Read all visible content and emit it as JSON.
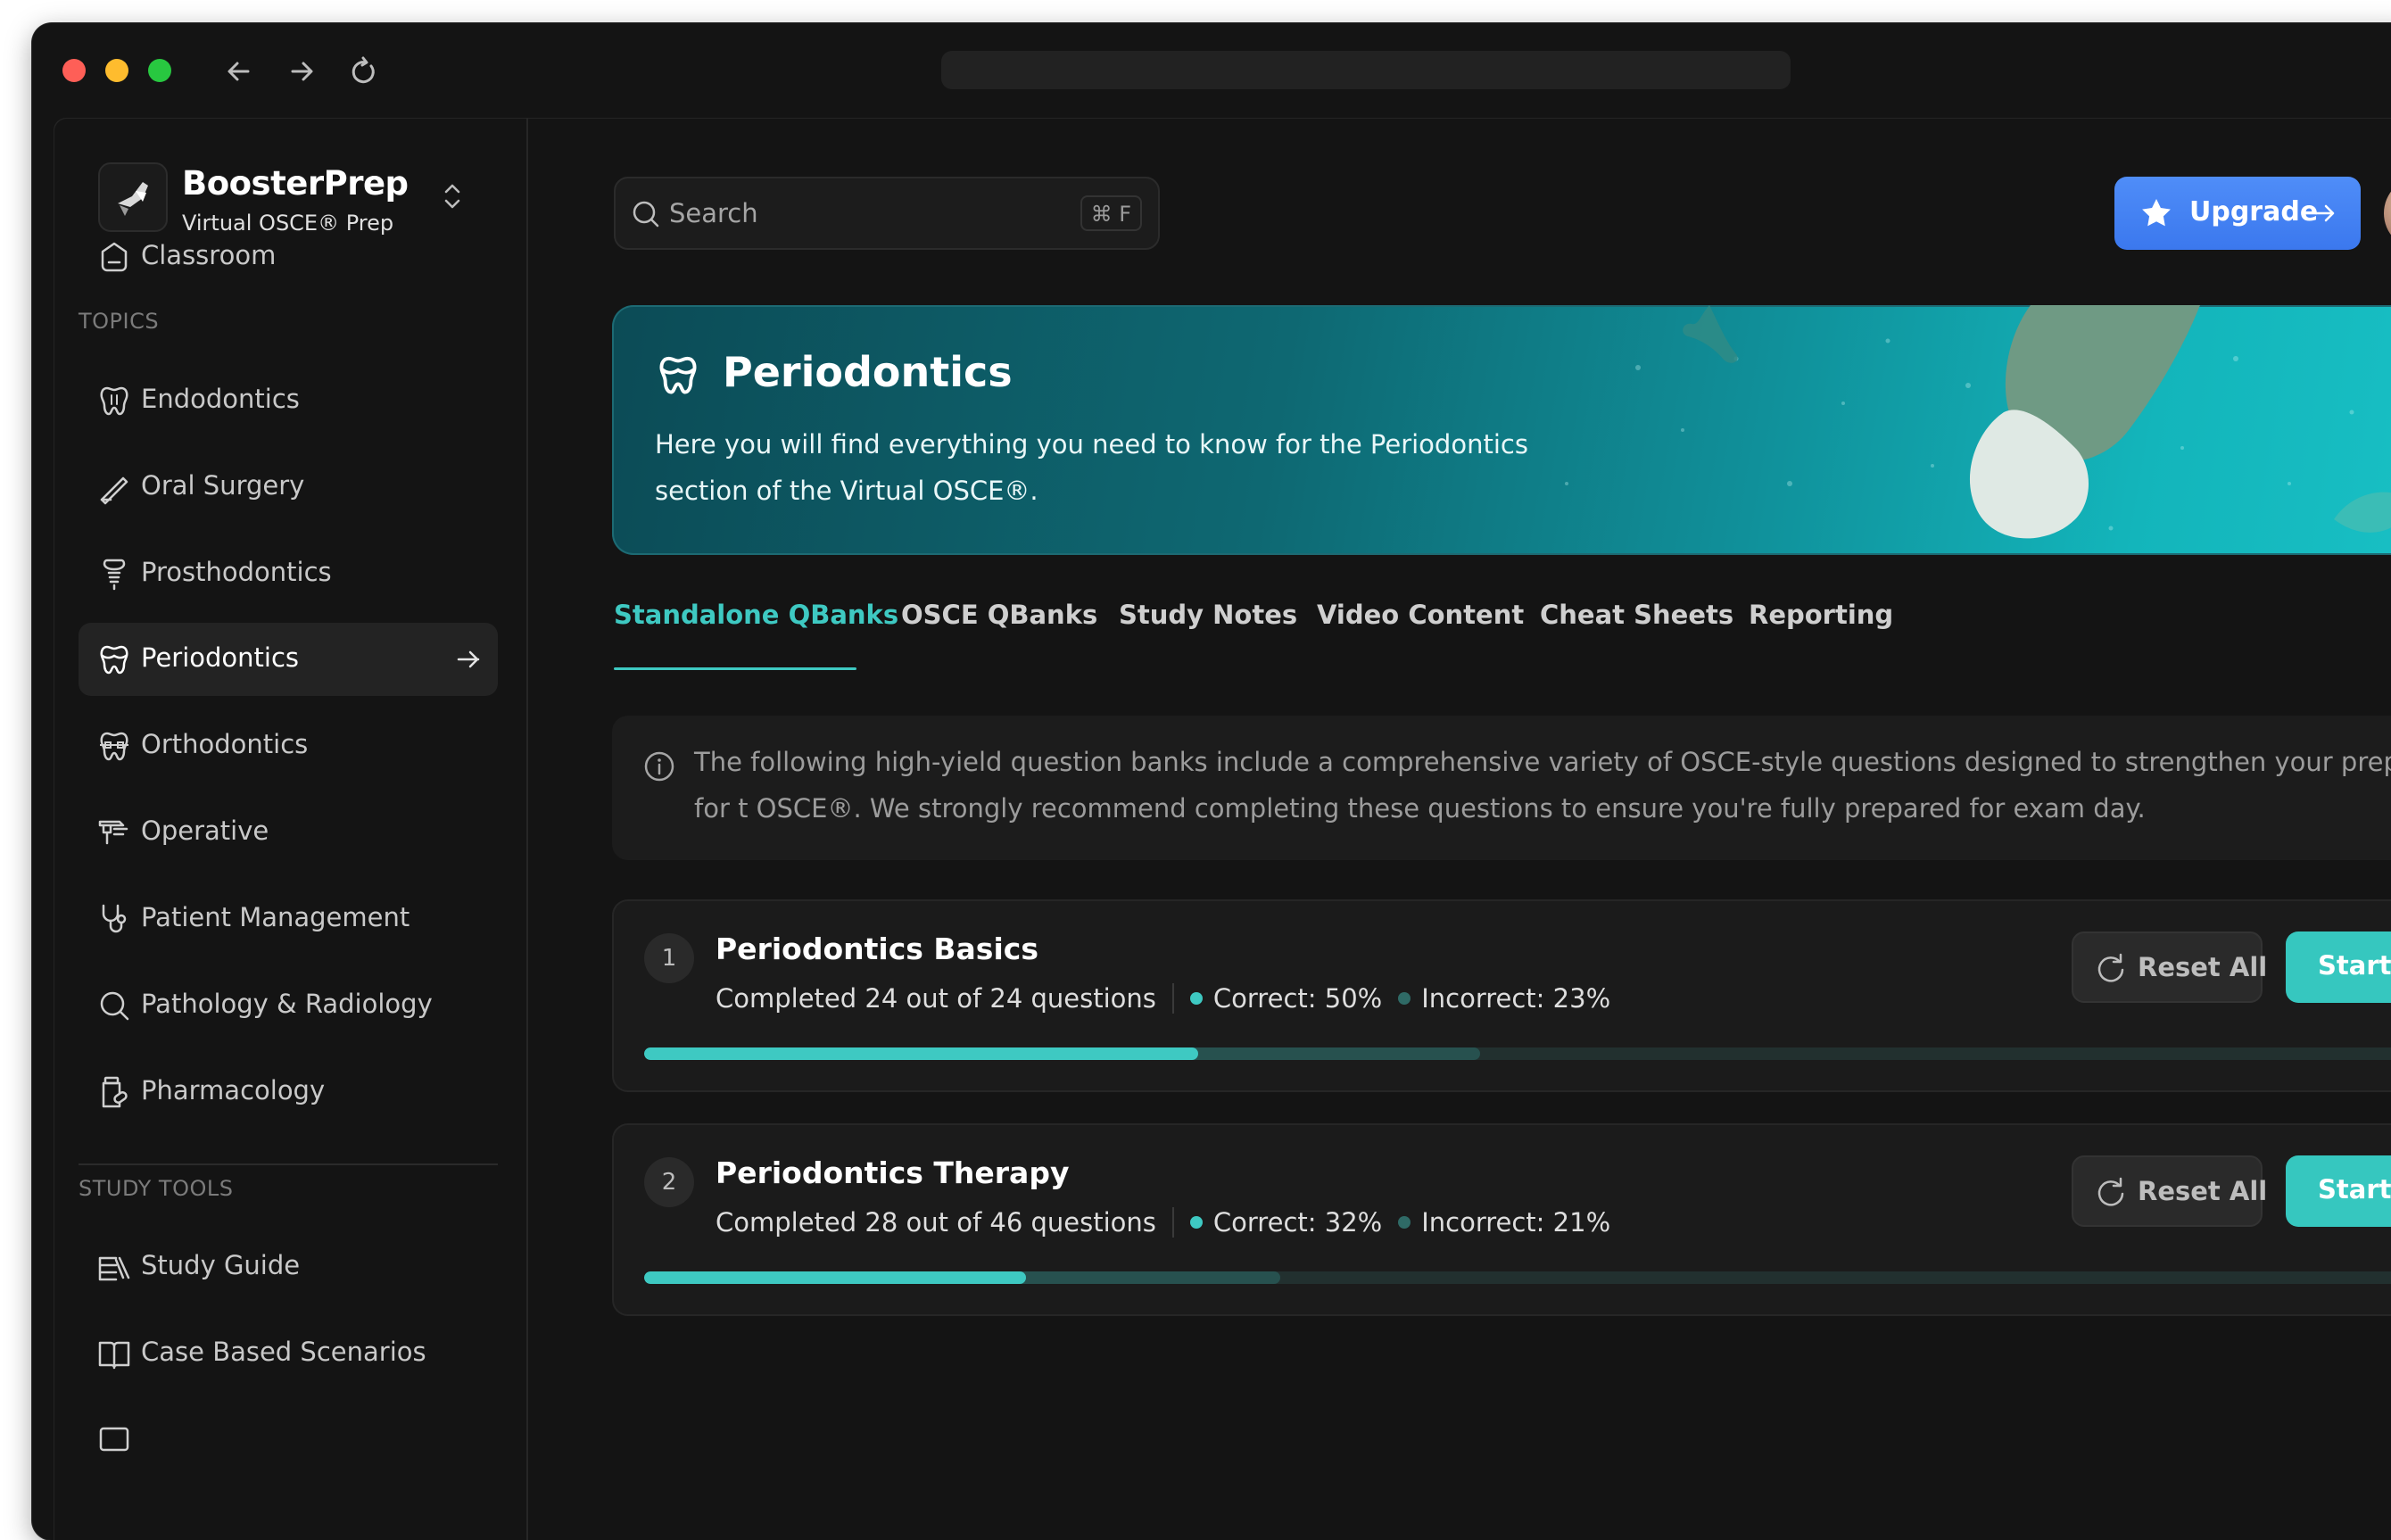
{
  "colors": {
    "accent": "#3ec9c2",
    "upgrade_blue": "#3f7ff0",
    "window_bg": "#141414",
    "correct_dot": "#3ec9c2",
    "incorrect_dot": "#2f6a66"
  },
  "brand": {
    "name": "BoosterPrep",
    "subtitle": "Virtual OSCE® Prep",
    "logo_icon": "boosterprep-logo-icon",
    "switch_icon": "chevron-up-down-icon"
  },
  "sidebar": {
    "classroom": {
      "label": "Classroom",
      "icon": "classroom-icon"
    },
    "topics_heading": "TOPICS",
    "topics": [
      {
        "label": "Endodontics",
        "icon": "tooth-icon"
      },
      {
        "label": "Oral Surgery",
        "icon": "scalpel-icon"
      },
      {
        "label": "Prosthodontics",
        "icon": "implant-icon"
      },
      {
        "label": "Periodontics",
        "icon": "gum-tooth-icon",
        "active": true
      },
      {
        "label": "Orthodontics",
        "icon": "braces-icon"
      },
      {
        "label": "Operative",
        "icon": "drill-icon"
      },
      {
        "label": "Patient Management",
        "icon": "stethoscope-icon"
      },
      {
        "label": "Pathology & Radiology",
        "icon": "magnifier-icon"
      },
      {
        "label": "Pharmacology",
        "icon": "medicine-bottle-icon"
      }
    ],
    "study_tools_heading": "STUDY TOOLS",
    "study_tools": [
      {
        "label": "Study Guide",
        "icon": "books-icon"
      },
      {
        "label": "Case Based Scenarios",
        "icon": "open-book-icon"
      }
    ]
  },
  "header": {
    "search_placeholder": "Search",
    "search_shortcut": "⌘ F",
    "upgrade_label": "Upgrade"
  },
  "hero": {
    "title": "Periodontics",
    "description": "Here you will find everything you need to know for the Periodontics section of the Virtual OSCE®."
  },
  "tabs": [
    {
      "label": "Standalone QBanks",
      "active": true
    },
    {
      "label": "OSCE QBanks"
    },
    {
      "label": "Study Notes"
    },
    {
      "label": "Video Content"
    },
    {
      "label": "Cheat Sheets"
    },
    {
      "label": "Reporting"
    }
  ],
  "info_text": "The following high-yield question banks include a comprehensive variety of OSCE-style questions designed to strengthen your preparation for t OSCE®. We strongly recommend completing these questions to ensure you're fully prepared for exam day.",
  "qbanks": [
    {
      "number": "1",
      "title": "Periodontics Basics",
      "completed": "Completed 24 out of 24 questions",
      "correct": "Correct: 50%",
      "incorrect": "Incorrect: 23%",
      "progress_correct": 0.29,
      "progress_answered": 0.438,
      "reset_label": "Reset All",
      "start_label": "Start Pra"
    },
    {
      "number": "2",
      "title": "Periodontics Therapy",
      "completed": "Completed 28 out of 46 questions",
      "correct": "Correct: 32%",
      "incorrect": "Incorrect: 21%",
      "progress_correct": 0.2,
      "progress_answered": 0.333,
      "reset_label": "Reset All",
      "start_label": "Start Pra"
    }
  ]
}
